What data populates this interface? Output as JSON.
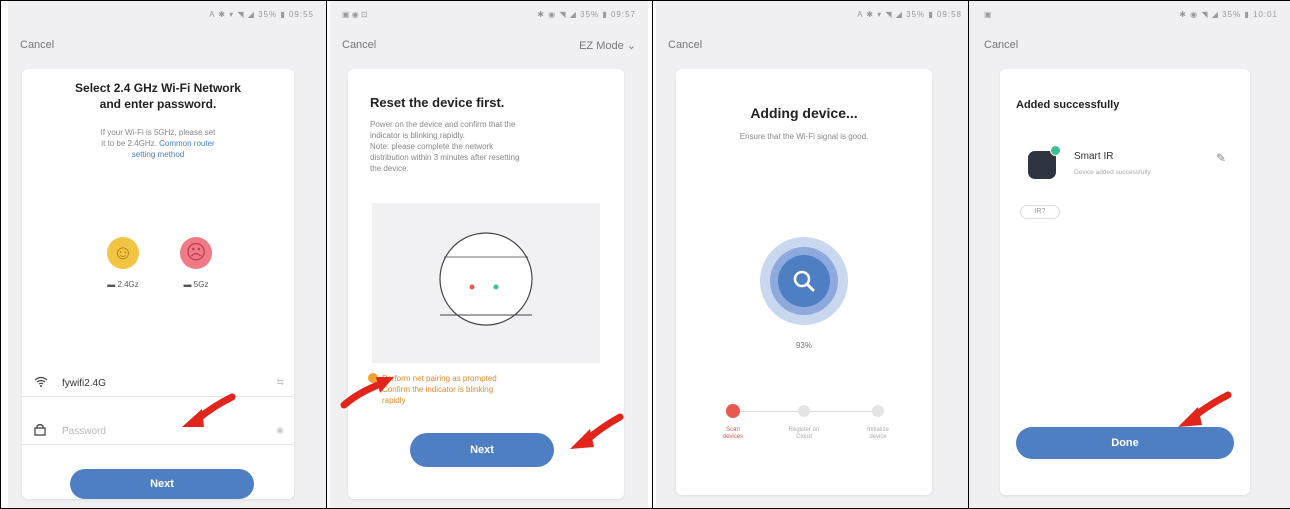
{
  "colors": {
    "accent": "#4f7fc3",
    "red_arrow": "#e1251b",
    "status_active": "#e85a4f"
  },
  "screens": [
    {
      "status_left": "",
      "status_right": "A ✱ ▾ ◥ ◢ 35% ▮ 09:55",
      "cancel": "Cancel",
      "title_line1": "Select 2.4 GHz Wi-Fi Network",
      "title_line2": "and enter password.",
      "note_line1": "If your Wi-Fi is 5GHz, please set",
      "note_line2": "it to be 2.4GHz.",
      "note_link": "Common router",
      "note_line3": "setting method",
      "band_24": "2.4Gz",
      "band_5": "5Gz",
      "wifi_value": "fywifi2.4G",
      "wifi_trail": "⇆",
      "password_placeholder": "Password",
      "password_trail": "◉",
      "next": "Next"
    },
    {
      "status_left": "▣ ◉ ⊡",
      "status_right": "✱ ◉ ◥ ◢ 35% ▮ 09:57",
      "cancel": "Cancel",
      "mode": "EZ Mode ⌄",
      "title": "Reset the device first.",
      "body_1": "Power on the device and confirm that the",
      "body_2": "indicator is blinking rapidly.",
      "body_3": "Note: please complete the network",
      "body_4": "distribution within 3 minutes after resetting",
      "body_5": "the device.",
      "check_1": "Perform net pairing as prompted",
      "check_2": "Confirm the indicator is blinking",
      "check_3": "rapidly",
      "next": "Next"
    },
    {
      "status_left": "",
      "status_right": "A ✱ ▾ ◥ ◢ 35% ▮ 09:58",
      "cancel": "Cancel",
      "title": "Adding device...",
      "subtitle": "Ensure that the Wi-Fi signal is good.",
      "percent_text": "93%",
      "percent_value": 93,
      "steps": [
        {
          "label_1": "Scan",
          "label_2": "devices"
        },
        {
          "label_1": "Register on",
          "label_2": "Cloud"
        },
        {
          "label_1": "Initialize",
          "label_2": "device"
        }
      ]
    },
    {
      "status_left": "▣",
      "status_right": "✱ ◉ ◥ ◢ 35% ▮ 10:01",
      "cancel": "Cancel",
      "title": "Added successfully",
      "device_name": "Smart IR",
      "device_status": "Device added successfully",
      "room_chip": "IR?",
      "edit_icon": "✎",
      "done": "Done"
    }
  ]
}
